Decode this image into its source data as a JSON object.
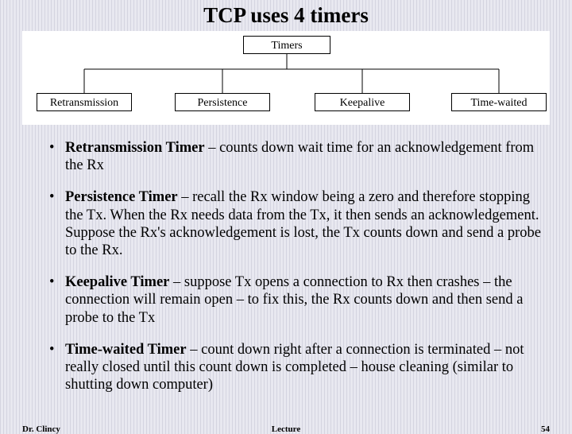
{
  "title": "TCP uses 4 timers",
  "diagram": {
    "root": "Timers",
    "children": [
      "Retransmission",
      "Persistence",
      "Keepalive",
      "Time-waited"
    ]
  },
  "bullets": [
    {
      "term": "Retransmission Timer",
      "body": " – counts down wait time for an acknowledgement from the Rx"
    },
    {
      "term": "Persistence Timer",
      "body": " – recall the Rx window being a zero and therefore stopping the Tx.  When the Rx needs data from the Tx, it then sends an acknowledgement.  Suppose the Rx's acknowledgement is lost, the Tx counts down and send a probe to the Rx."
    },
    {
      "term": "Keepalive Timer",
      "body": " – suppose Tx opens a connection to Rx then crashes – the connection will remain open – to fix this, the Rx counts down and then send a probe to the Tx"
    },
    {
      "term": "Time-waited Timer",
      "body": " – count down right after a connection is terminated – not really closed until this count down is completed – house cleaning (similar to shutting down computer)"
    }
  ],
  "footer": {
    "left": "Dr. Clincy",
    "center": "Lecture",
    "right": "54"
  }
}
